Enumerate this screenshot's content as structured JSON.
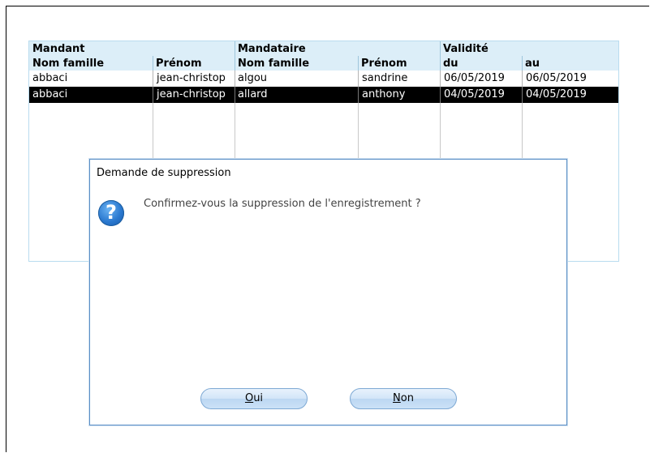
{
  "table": {
    "group_headers": {
      "mandant": "Mandant",
      "mandataire": "Mandataire",
      "validite": "Validité"
    },
    "columns": [
      "Nom famille",
      "Prénom",
      "Nom famille",
      "Prénom",
      "du",
      "au"
    ],
    "rows": [
      [
        "abbaci",
        "jean-christop",
        "algou",
        "sandrine",
        "06/05/2019",
        "06/05/2019"
      ],
      [
        "abbaci",
        "jean-christop",
        "allard",
        "anthony",
        "04/05/2019",
        "04/05/2019"
      ]
    ],
    "selected_row_index": 1
  },
  "dialog": {
    "title": "Demande de suppression",
    "icon": "question-icon",
    "message": "Confirmez-vous la suppression de l'enregistrement ?",
    "yes_mnemonic": "O",
    "yes_rest": "ui",
    "no_mnemonic": "N",
    "no_rest": "on"
  },
  "colors": {
    "header_bg": "#dceef8",
    "grid_border": "#b9dcef",
    "selected_bg": "#000000",
    "dialog_border": "#5a8fc6",
    "button_bg": "#cbe1f7"
  }
}
